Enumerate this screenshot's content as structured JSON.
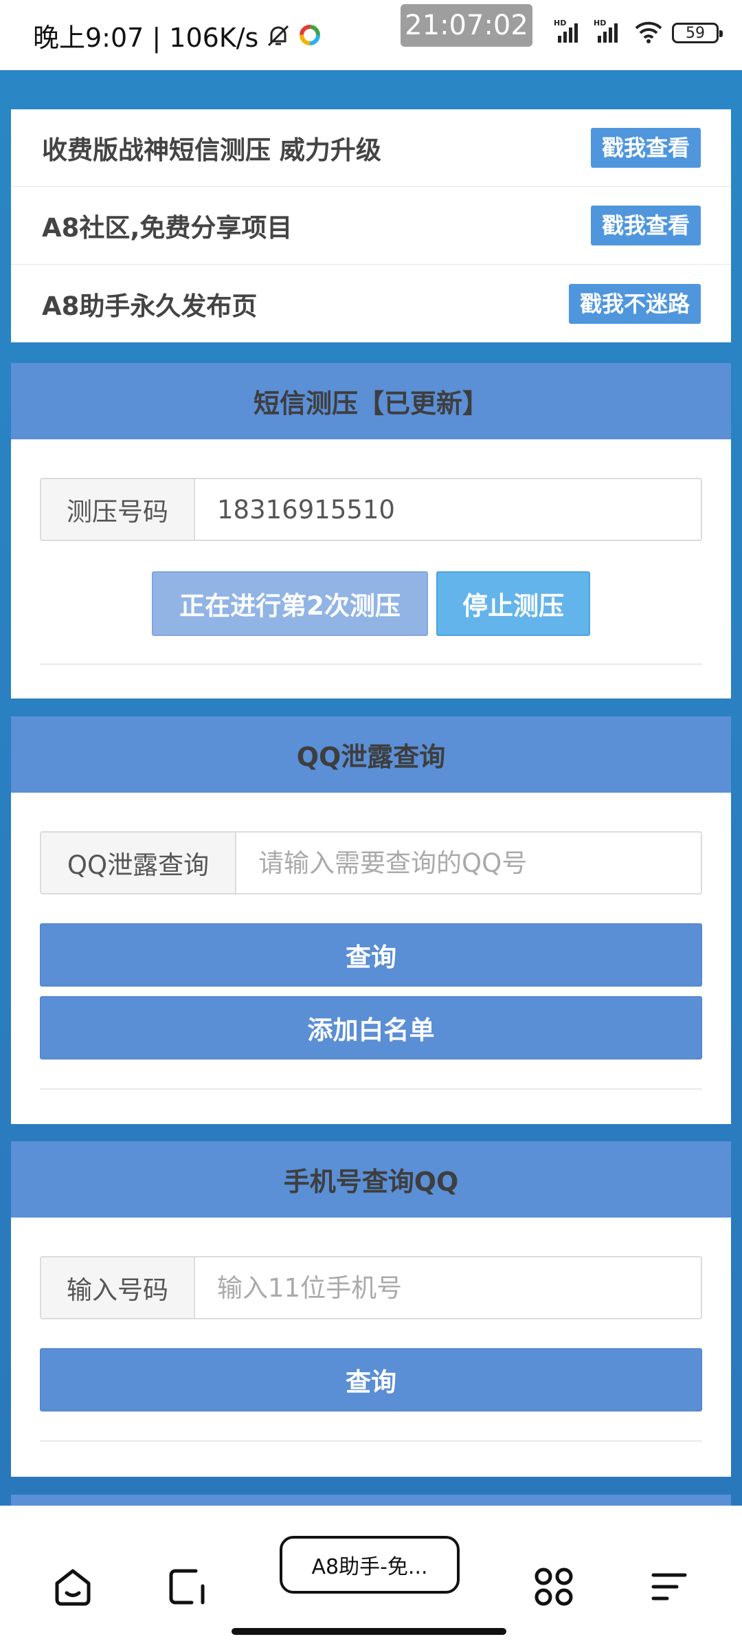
{
  "status_bar": {
    "left_text": "晚上9:07 | 106K/s",
    "time_pill": "21:07:02",
    "battery": "59",
    "icons": [
      "mute-bell-icon",
      "app-notification-icon",
      "hd-signal-icon",
      "hd-signal-icon",
      "wifi-icon",
      "battery-icon"
    ]
  },
  "promos": [
    {
      "text": "收费版战神短信测压 威力升级",
      "button": "戳我查看"
    },
    {
      "text": "A8社区,免费分享项目",
      "button": "戳我查看"
    },
    {
      "text": "A8助手永久发布页",
      "button": "戳我不迷路"
    }
  ],
  "sms_panel": {
    "title": "短信测压【已更新】",
    "label": "测压号码",
    "value": "18316915510",
    "progress_button": "正在进行第2次测压",
    "stop_button": "停止测压"
  },
  "qq_leak_panel": {
    "title": "QQ泄露查询",
    "label": "QQ泄露查询",
    "placeholder": "请输入需要查询的QQ号",
    "query_button": "查询",
    "whitelist_button": "添加白名单"
  },
  "phone_qq_panel": {
    "title": "手机号查询QQ",
    "label": "输入号码",
    "placeholder": "输入11位手机号",
    "query_button": "查询"
  },
  "bottom_nav": {
    "tab_title": "A8助手-免...",
    "icons": [
      "home-icon",
      "tab-switch-icon",
      "apps-grid-icon",
      "menu-icon"
    ]
  },
  "colors": {
    "page_bg": "#2a86c4",
    "panel_header": "#5b8fd6",
    "primary_button": "#5a8ed5",
    "promo_button": "#4f96dd",
    "stop_button": "#63b4ea"
  }
}
